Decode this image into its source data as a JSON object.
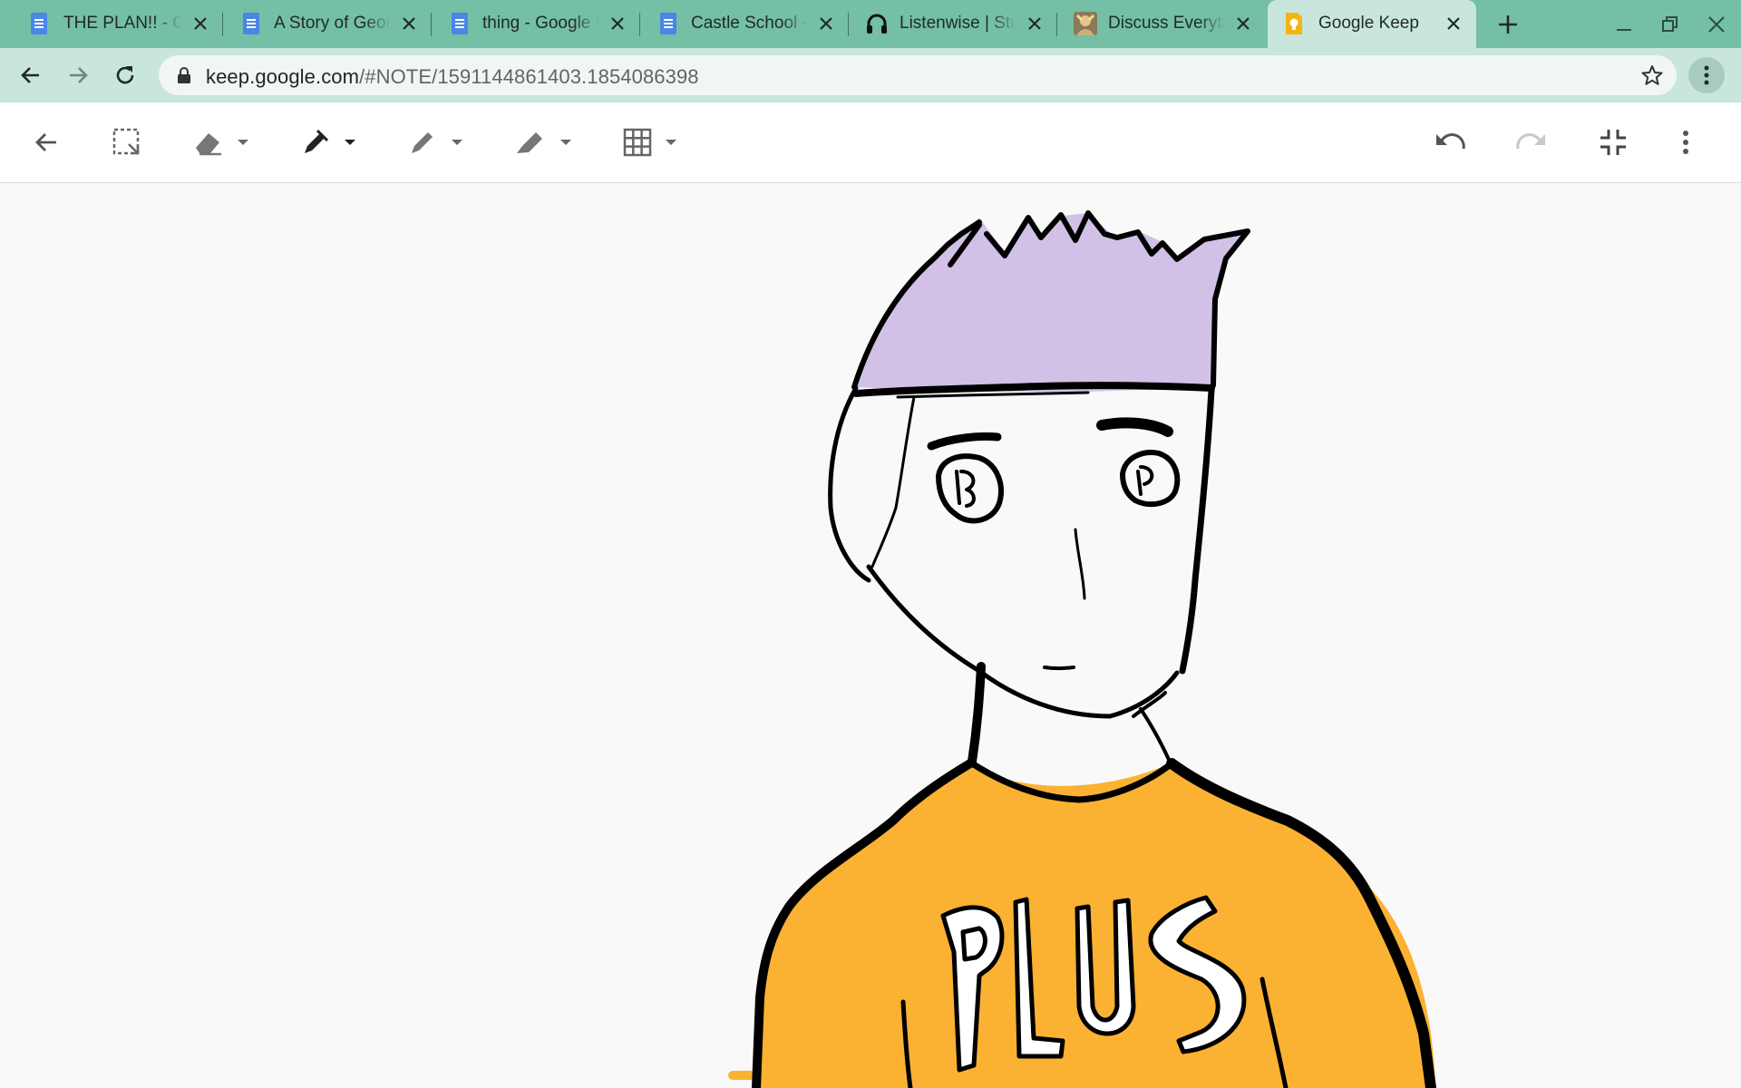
{
  "browser": {
    "tabs": [
      {
        "title": "THE PLAN!! - G",
        "icon": "google-docs-icon"
      },
      {
        "title": "A Story of Geor",
        "icon": "google-docs-icon"
      },
      {
        "title": "thing - Google D",
        "icon": "google-docs-icon"
      },
      {
        "title": "Castle School -",
        "icon": "google-docs-icon"
      },
      {
        "title": "Listenwise | Stu",
        "icon": "headphones-icon"
      },
      {
        "title": "Discuss Everyth",
        "icon": "avatar-icon"
      },
      {
        "title": "Google Keep",
        "icon": "google-keep-icon"
      }
    ],
    "url_host": "keep.google.com",
    "url_path": "/#NOTE/1591144861403.1854086398",
    "colors": {
      "tab_strip": "#74bfa6",
      "toolbar": "#c9e6dc"
    }
  },
  "drawing": {
    "shirt_text": "PLUS",
    "colors": {
      "hair": "#d2c1e6",
      "shirt": "#fbb232",
      "outline": "#000000",
      "canvas": "#f9f9f9"
    }
  }
}
